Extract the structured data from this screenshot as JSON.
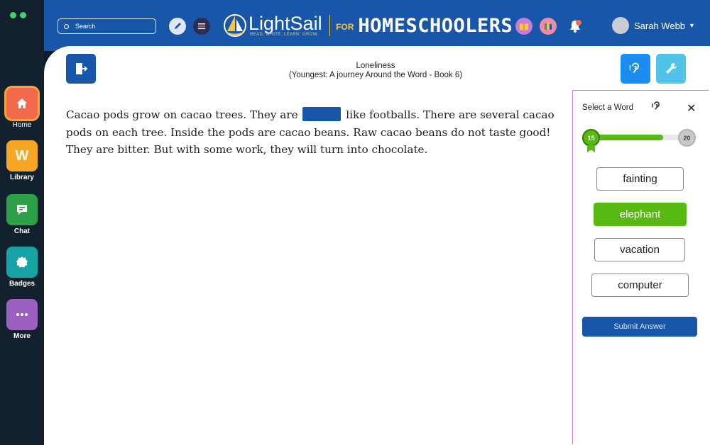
{
  "window": {
    "traffic_dots": [
      "#3fd26b",
      "#3fd26b"
    ]
  },
  "sidebar": {
    "items": [
      {
        "label": "Home",
        "icon": "home-icon",
        "color": "#f26a4b",
        "active": true
      },
      {
        "label": "Library",
        "icon": "library-icon",
        "color": "#f6a623"
      },
      {
        "label": "Chat",
        "icon": "chat-icon",
        "color": "#2fa04a"
      },
      {
        "label": "Badges",
        "icon": "badge-icon",
        "color": "#16a3a3"
      },
      {
        "label": "More",
        "icon": "more-icon",
        "color": "#9b5fc0"
      }
    ]
  },
  "header": {
    "search_placeholder": "Search",
    "brand_name": "LightSail",
    "brand_tagline": "READ. WRITE. LEARN. GROW.",
    "brand_for": "FOR",
    "brand_audience": "HOMESCHOOLERS",
    "notification_count": "1",
    "user_name": "Sarah Webb",
    "colors": {
      "bar": "#1756a9",
      "accent": "#f6c548"
    }
  },
  "book": {
    "title": "Loneliness",
    "subtitle": "(Youngest: A journey Around the Word - Book 6)"
  },
  "passage": {
    "before_blank": "Cacao pods grow on cacao trees. They are",
    "after_blank": "like footballs. There are several cacao pods on each tree. Inside the pods are cacao beans. Raw cacao beans do not taste good! They are bitter. But with some work, they will turn into chocolate."
  },
  "word_panel": {
    "title": "Select a Word",
    "progress": {
      "current": "15",
      "total": "20",
      "fraction": 0.75
    },
    "choices": [
      "fainting",
      "elephant",
      "vacation",
      "computer"
    ],
    "selected": "elephant",
    "submit_label": "Submit Answer"
  },
  "colors": {
    "primary": "#1756a9",
    "selected": "#57b912",
    "panel_border": "#c97cd6",
    "tool_blue": "#1a8ef0",
    "tool_cyan": "#4fc3e8"
  }
}
